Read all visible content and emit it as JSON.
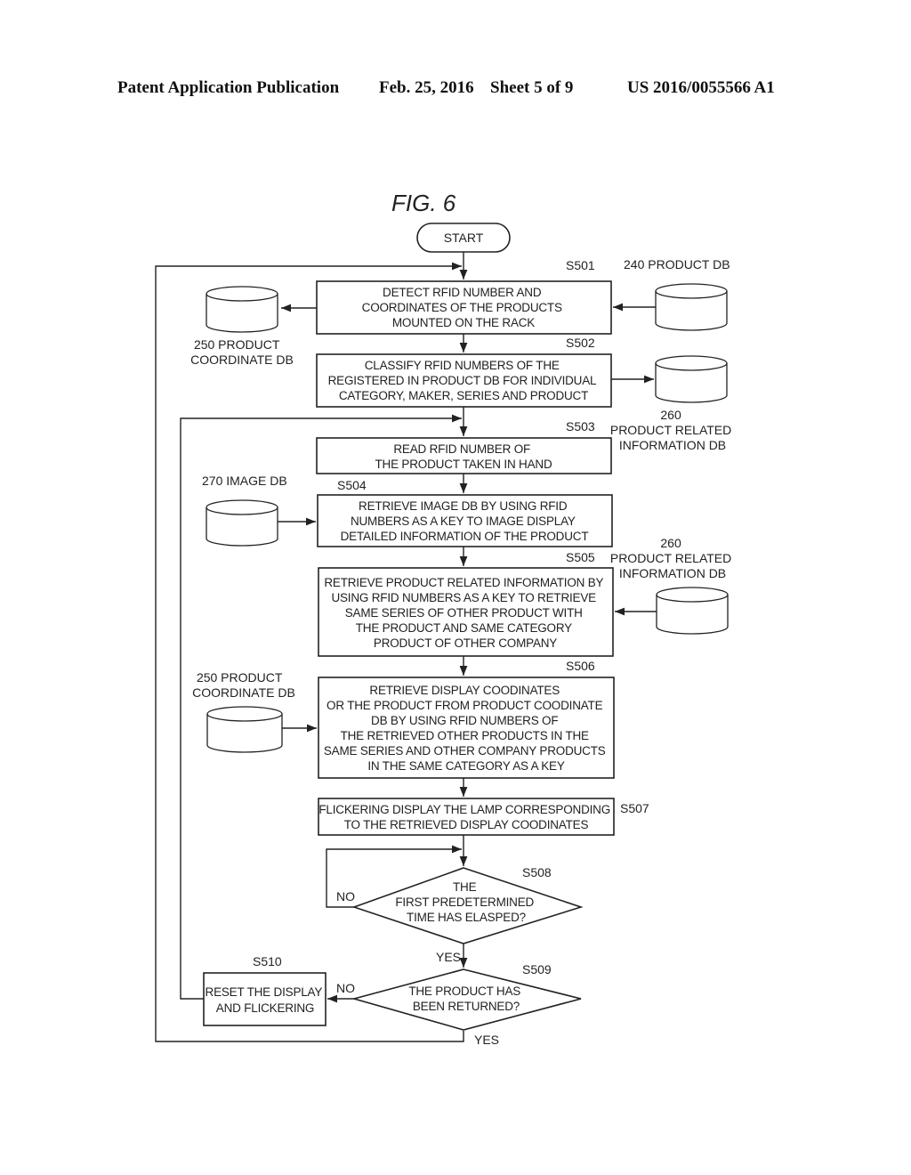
{
  "header": {
    "publication": "Patent Application Publication",
    "date": "Feb. 25, 2016",
    "sheet": "Sheet 5 of 9",
    "number": "US 2016/0055566 A1"
  },
  "figure": {
    "title": "FIG. 6",
    "start_label": "START",
    "steps": [
      {
        "id": "S501",
        "lines": [
          "DETECT RFID NUMBER AND",
          "COORDINATES OF THE PRODUCTS",
          "MOUNTED ON THE RACK"
        ]
      },
      {
        "id": "S502",
        "lines": [
          "CLASSIFY RFID NUMBERS OF THE",
          "REGISTERED IN PRODUCT DB FOR INDIVIDUAL",
          "CATEGORY, MAKER, SERIES AND PRODUCT"
        ]
      },
      {
        "id": "S503",
        "lines": [
          "READ RFID NUMBER OF",
          "THE PRODUCT TAKEN IN HAND"
        ]
      },
      {
        "id": "S504",
        "lines": [
          "RETRIEVE IMAGE DB BY USING RFID",
          "NUMBERS AS A KEY TO IMAGE DISPLAY",
          "DETAILED INFORMATION OF THE PRODUCT"
        ]
      },
      {
        "id": "S505",
        "lines": [
          "RETRIEVE PRODUCT RELATED INFORMATION BY",
          "USING RFID NUMBERS AS A KEY TO RETRIEVE",
          "SAME SERIES OF OTHER PRODUCT WITH",
          "THE PRODUCT AND SAME CATEGORY",
          "PRODUCT OF OTHER COMPANY"
        ]
      },
      {
        "id": "S506",
        "lines": [
          "RETRIEVE DISPLAY COODINATES",
          "OR THE PRODUCT FROM PRODUCT COODINATE",
          "DB BY USING RFID NUMBERS OF",
          "THE RETRIEVED OTHER PRODUCTS IN THE",
          "SAME SERIES AND OTHER COMPANY PRODUCTS",
          "IN THE SAME CATEGORY AS A KEY"
        ]
      },
      {
        "id": "S507",
        "lines": [
          "FLICKERING DISPLAY THE LAMP CORRESPONDING",
          "TO THE RETRIEVED DISPLAY COODINATES"
        ]
      },
      {
        "id": "S508",
        "lines": [
          "THE",
          "FIRST PREDETERMINED",
          "TIME HAS ELASPED?"
        ]
      },
      {
        "id": "S509",
        "lines": [
          "THE PRODUCT HAS",
          "BEEN RETURNED?"
        ]
      },
      {
        "id": "S510",
        "lines": [
          "RESET THE DISPLAY",
          "AND FLICKERING"
        ]
      }
    ],
    "databases": {
      "db240": [
        "240 PRODUCT DB"
      ],
      "db250_top": [
        "250 PRODUCT",
        "COORDINATE DB"
      ],
      "db260_top": [
        "260",
        "PRODUCT RELATED",
        "INFORMATION DB"
      ],
      "db270": [
        "270 IMAGE DB"
      ],
      "db260_mid": [
        "260",
        "PRODUCT RELATED",
        "INFORMATION DB"
      ],
      "db250_mid": [
        "250 PRODUCT",
        "COORDINATE DB"
      ]
    },
    "branch_labels": {
      "s508_no": "NO",
      "s508_yes": "YES",
      "s509_no": "NO",
      "s509_yes": "YES"
    }
  }
}
